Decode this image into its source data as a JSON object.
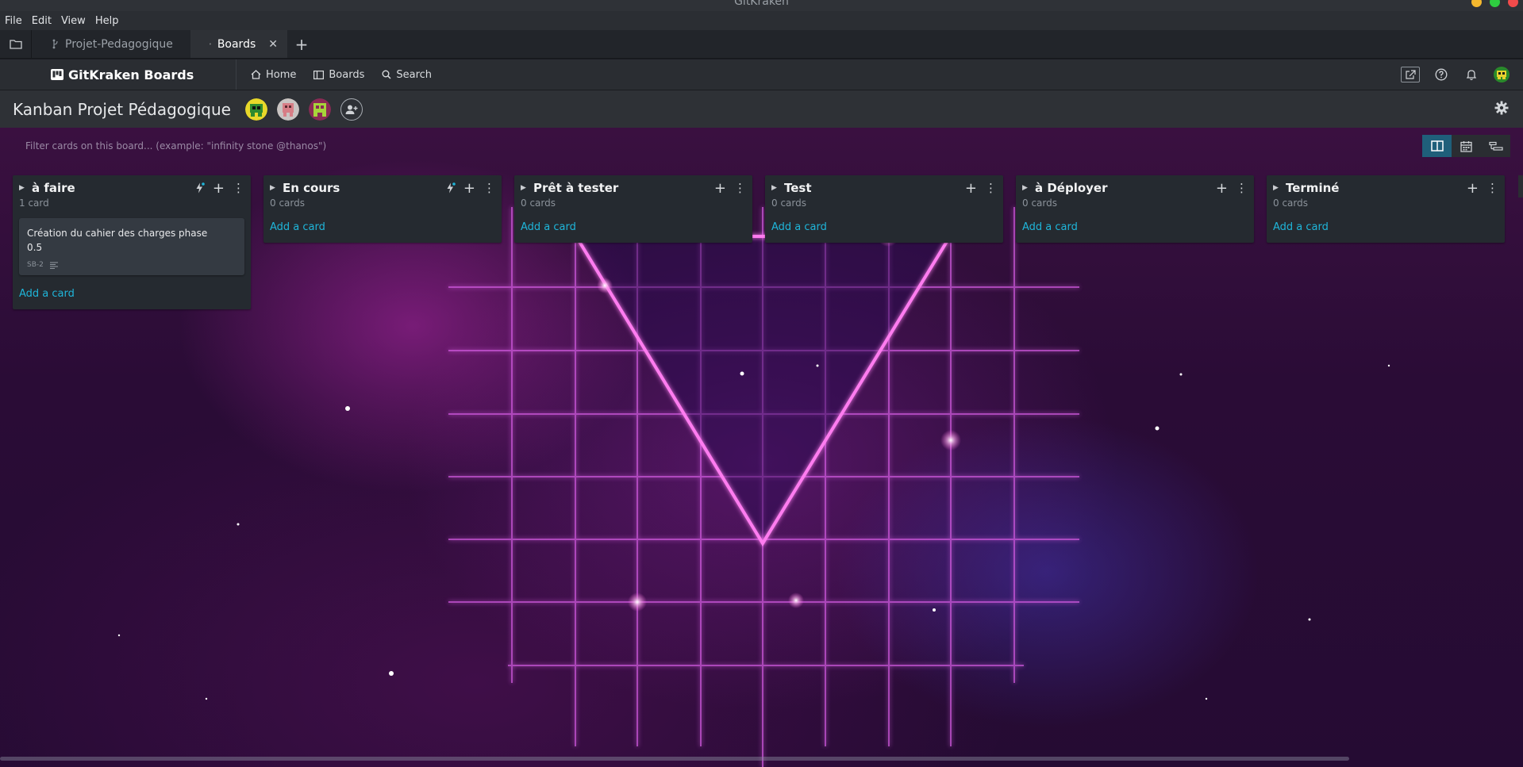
{
  "window": {
    "title": "GitKraken"
  },
  "menu": [
    "File",
    "Edit",
    "View",
    "Help"
  ],
  "tabs": [
    {
      "label": "Projet-Pedagogique",
      "icon": "repo-branch-icon"
    },
    {
      "label": "Boards",
      "icon": "board-icon",
      "active": true
    }
  ],
  "header": {
    "brand": "GitKraken Boards",
    "nav": {
      "home": "Home",
      "boards": "Boards",
      "search": "Search"
    }
  },
  "board": {
    "title": "Kanban Projet Pédagogique",
    "filter_placeholder": "Filter cards on this board... (example: \"infinity stone @thanos\")"
  },
  "columns": [
    {
      "title": "à faire",
      "count": "1 card",
      "add": "Add a card",
      "has_automation": true
    },
    {
      "title": "En cours",
      "count": "0 cards",
      "add": "Add a card",
      "has_automation": true
    },
    {
      "title": "Prêt à tester",
      "count": "0 cards",
      "add": "Add a card"
    },
    {
      "title": "Test",
      "count": "0 cards",
      "add": "Add a card"
    },
    {
      "title": "à Déployer",
      "count": "0 cards",
      "add": "Add a card"
    },
    {
      "title": "Terminé",
      "count": "0 cards",
      "add": "Add a card"
    }
  ],
  "cards": [
    {
      "title": "Création du cahier des charges phase 0.5",
      "id": "SB-2"
    }
  ],
  "colors": {
    "accent": "#1fb5d9",
    "window_close": "#f24b4b",
    "window_max": "#2ecc40",
    "window_min": "#f5b82e"
  }
}
